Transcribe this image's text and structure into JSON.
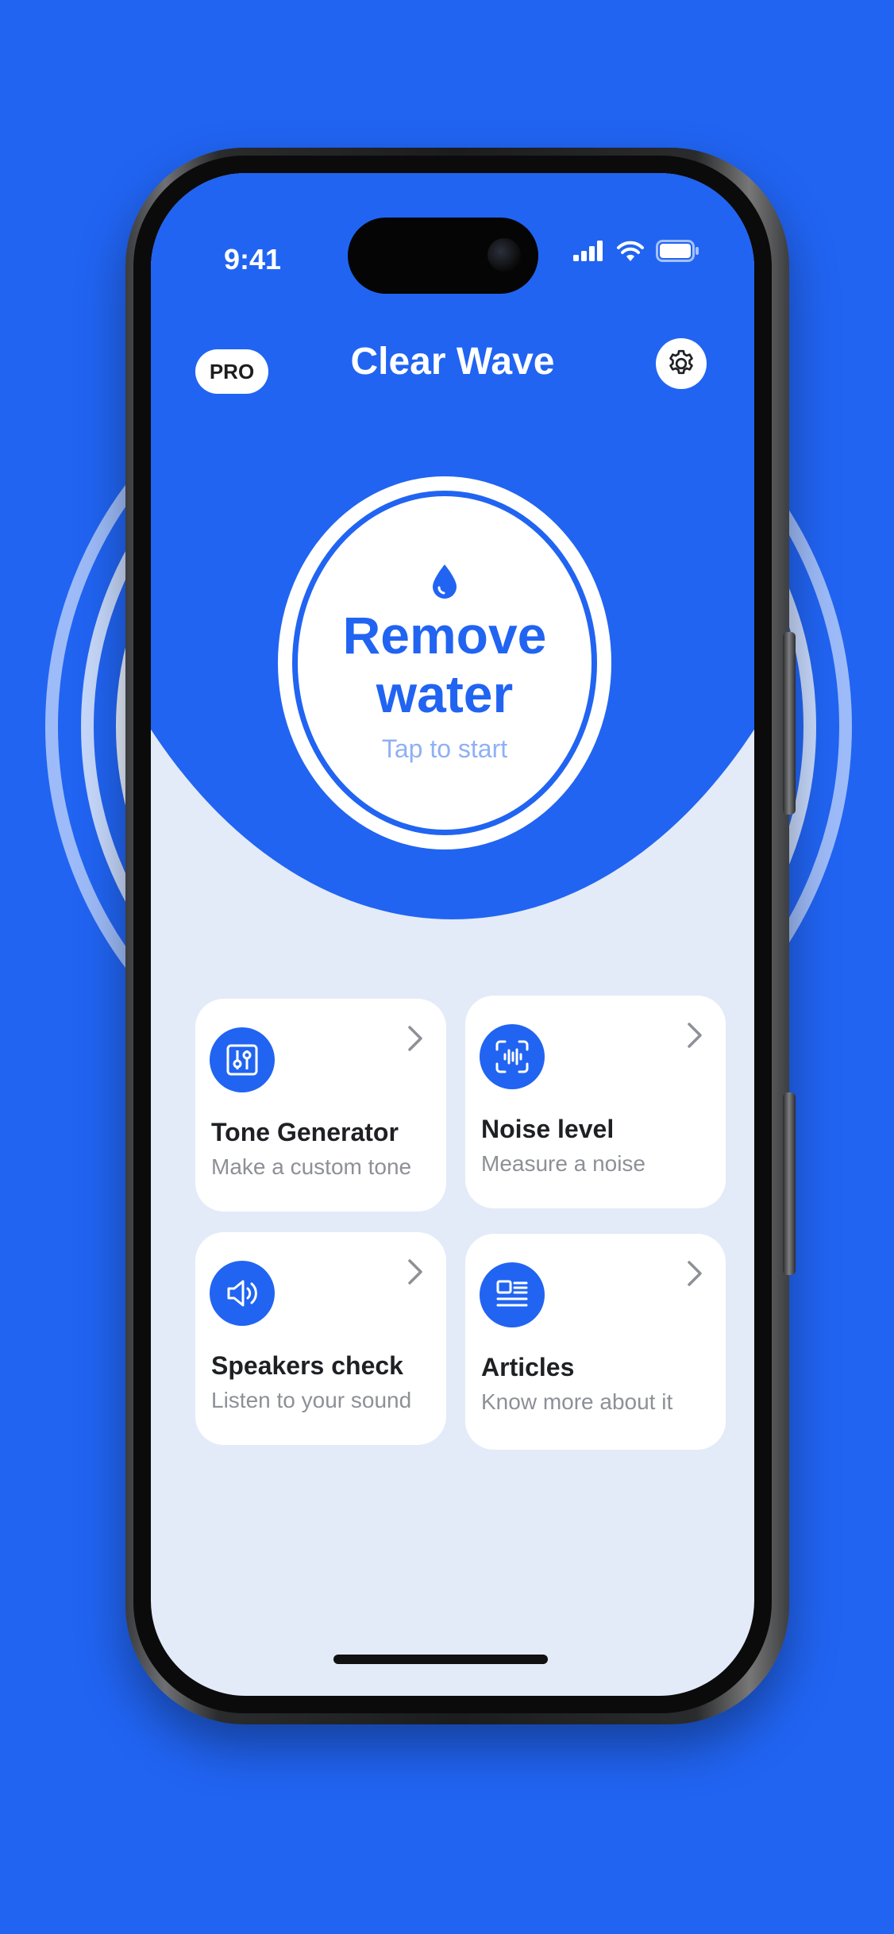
{
  "status_bar": {
    "time": "9:41",
    "icons": [
      "signal-icon",
      "wifi-icon",
      "battery-icon"
    ]
  },
  "header": {
    "pro_label": "PRO",
    "title": "Clear Wave",
    "settings_icon": "gear-icon"
  },
  "main_button": {
    "title_line1": "Remove",
    "title_line2": "water",
    "subtitle": "Tap to start",
    "icon": "water-drop-icon"
  },
  "cards": [
    {
      "title": "Tone Generator",
      "subtitle": "Make a custom tone",
      "icon": "sliders-icon"
    },
    {
      "title": "Noise level",
      "subtitle": "Measure a noise",
      "icon": "sound-scan-icon"
    },
    {
      "title": "Speakers check",
      "subtitle": "Listen to your sound",
      "icon": "speaker-icon"
    },
    {
      "title": "Articles",
      "subtitle": "Know more about it",
      "icon": "article-icon"
    }
  ],
  "colors": {
    "accent": "#2164F2",
    "background": "#2164F2",
    "screen_bg": "#E3EBF8",
    "subtitle_light": "#8FB0F5",
    "card_subtitle": "#8D9096"
  }
}
